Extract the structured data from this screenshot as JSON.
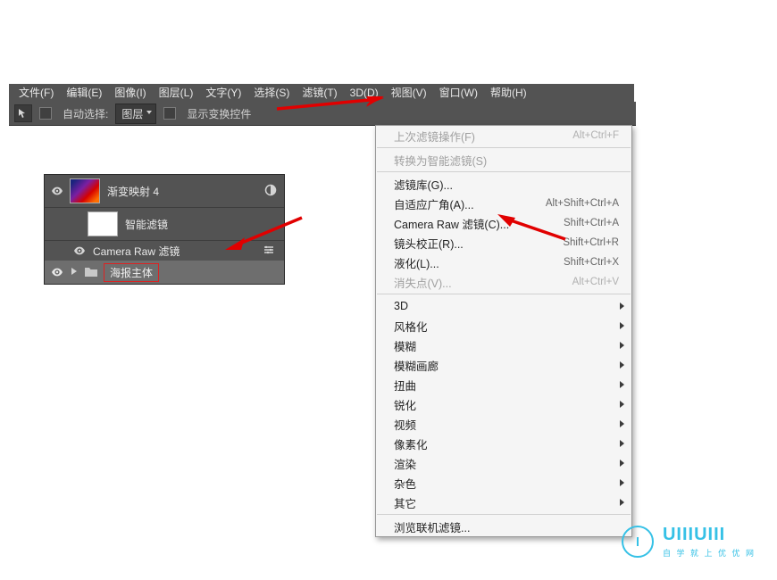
{
  "menubar": {
    "items": [
      {
        "label": "文件(F)"
      },
      {
        "label": "编辑(E)"
      },
      {
        "label": "图像(I)"
      },
      {
        "label": "图层(L)"
      },
      {
        "label": "文字(Y)"
      },
      {
        "label": "选择(S)"
      },
      {
        "label": "滤镜(T)"
      },
      {
        "label": "3D(D)"
      },
      {
        "label": "视图(V)"
      },
      {
        "label": "窗口(W)"
      },
      {
        "label": "帮助(H)"
      }
    ]
  },
  "toolbar": {
    "auto_select": "自动选择:",
    "layer_sel": "图层",
    "show_transform": "显示变换控件"
  },
  "layers": {
    "l0": {
      "name": "渐变映射 4"
    },
    "smart": "智能滤镜",
    "crfilter": "Camera Raw 滤镜",
    "group": "海报主体"
  },
  "filtermenu": {
    "last": {
      "label": "上次滤镜操作(F)",
      "kb": "Alt+Ctrl+F"
    },
    "convert": {
      "label": "转换为智能滤镜(S)"
    },
    "gallery": {
      "label": "滤镜库(G)..."
    },
    "adaptive": {
      "label": "自适应广角(A)...",
      "kb": "Alt+Shift+Ctrl+A"
    },
    "craw": {
      "label": "Camera Raw 滤镜(C)...",
      "kb": "Shift+Ctrl+A"
    },
    "lens": {
      "label": "镜头校正(R)...",
      "kb": "Shift+Ctrl+R"
    },
    "liquify": {
      "label": "液化(L)...",
      "kb": "Shift+Ctrl+X"
    },
    "vanish": {
      "label": "消失点(V)...",
      "kb": "Alt+Ctrl+V"
    },
    "sub3d": {
      "label": "3D"
    },
    "style": {
      "label": "风格化"
    },
    "blur": {
      "label": "模糊"
    },
    "blurg": {
      "label": "模糊画廊"
    },
    "distort": {
      "label": "扭曲"
    },
    "sharpen": {
      "label": "锐化"
    },
    "video": {
      "label": "视频"
    },
    "pixel": {
      "label": "像素化"
    },
    "render": {
      "label": "渲染"
    },
    "noise": {
      "label": "杂色"
    },
    "other": {
      "label": "其它"
    },
    "browse": {
      "label": "浏览联机滤镜..."
    }
  },
  "brand": {
    "text": "UIIIUIII",
    "sub": "自 学 就 上 优 优 网"
  }
}
